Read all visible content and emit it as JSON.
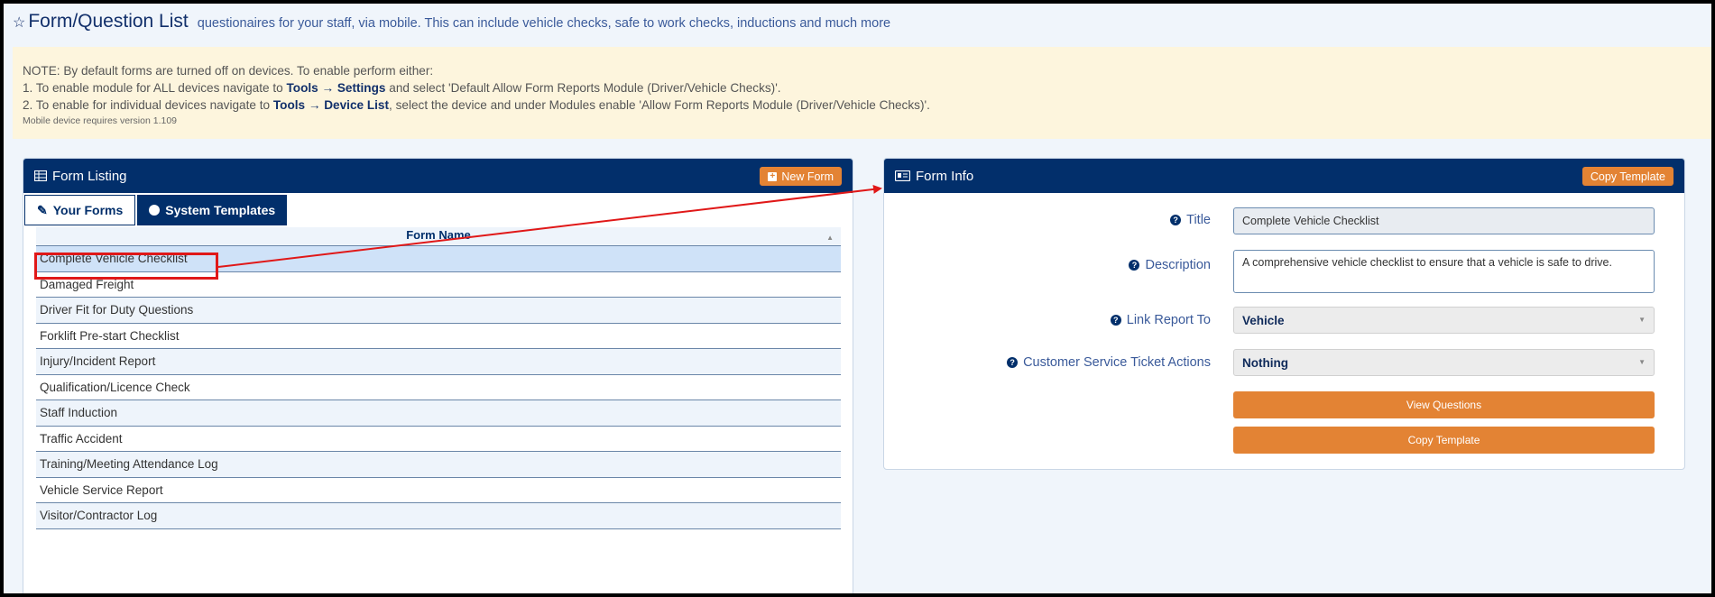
{
  "header": {
    "title": "Form/Question List",
    "subtitle": "questionaires for your staff, via mobile. This can include vehicle checks, safe to work checks, inductions and much more"
  },
  "note": {
    "line1": "NOTE: By default forms are turned off on devices. To enable perform either:",
    "line2_pre": "1. To enable module for ALL devices navigate to ",
    "line2_bold": "Tools → Settings",
    "line2_post": " and select 'Default Allow Form Reports Module (Driver/Vehicle Checks)'.",
    "line3_pre": "2. To enable for individual devices navigate to ",
    "line3_bold": "Tools → Device List",
    "line3_post": ", select the device and under Modules enable 'Allow Form Reports Module (Driver/Vehicle Checks)'.",
    "version": "Mobile device requires version 1.109"
  },
  "form_listing": {
    "title": "Form Listing",
    "new_form_label": "New Form",
    "tabs": [
      {
        "label": "Your Forms",
        "active": false
      },
      {
        "label": "System Templates",
        "active": true
      }
    ],
    "column_header": "Form Name",
    "rows": [
      "Complete Vehicle Checklist",
      "Damaged Freight",
      "Driver Fit for Duty Questions",
      "Forklift Pre-start Checklist",
      "Injury/Incident Report",
      "Qualification/Licence Check",
      "Staff Induction",
      "Traffic Accident",
      "Training/Meeting Attendance Log",
      "Vehicle Service Report",
      "Visitor/Contractor Log"
    ],
    "selected_index": 0
  },
  "form_info": {
    "title": "Form Info",
    "copy_template_label": "Copy Template",
    "fields": {
      "title_label": "Title",
      "title_value": "Complete Vehicle Checklist",
      "description_label": "Description",
      "description_value": "A comprehensive vehicle checklist to ensure that a vehicle is safe to drive.",
      "link_label": "Link Report To",
      "link_value": "Vehicle",
      "cst_label": "Customer Service Ticket Actions",
      "cst_value": "Nothing"
    },
    "view_questions_label": "View Questions",
    "copy_template_button_label": "Copy Template"
  },
  "colors": {
    "navy": "#022f6b",
    "orange": "#e38334",
    "annotation_red": "#e01818",
    "note_bg": "#fdf5dd"
  }
}
